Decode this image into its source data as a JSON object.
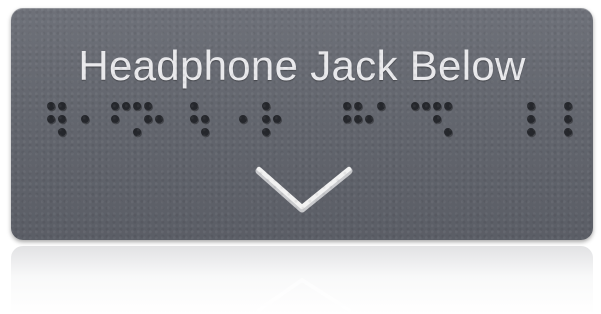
{
  "sign": {
    "text": "Headphone Jack Below",
    "text_color": "#e9e9ec",
    "background_color": "#63666e",
    "arrow_color": "#f2f2f2",
    "braille_dot_color": "#25272c"
  }
}
